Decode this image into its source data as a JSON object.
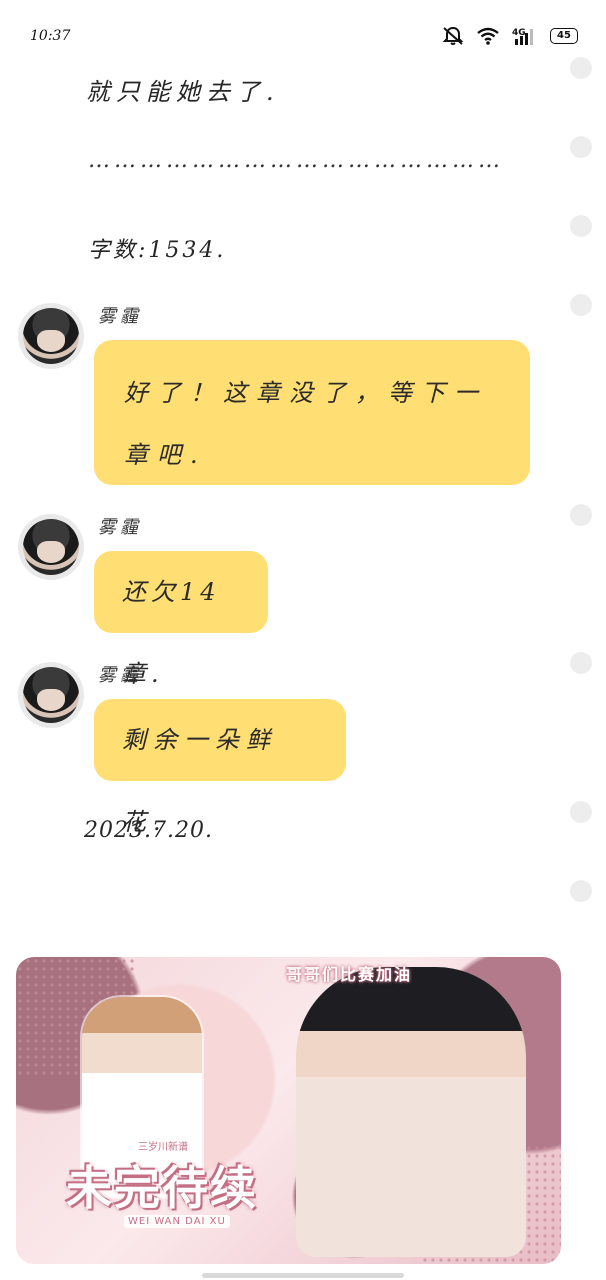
{
  "status_bar": {
    "time": "10:37",
    "battery": "45",
    "icons": [
      "bell-muted-icon",
      "wifi-icon",
      "signal-4g-icon",
      "battery-icon"
    ]
  },
  "content": {
    "line1": "就只能她去了.",
    "dots_line": "…………………………………………",
    "word_count": "字数:1534.",
    "date": "2023.7.20."
  },
  "chat": [
    {
      "name": "雾霾",
      "message": "好了！这章没了，等下一章吧."
    },
    {
      "name": "雾霾",
      "message": "还欠14章."
    },
    {
      "name": "雾霾",
      "message": "剩余一朵鲜花."
    }
  ],
  "banner": {
    "top_text": "哥哥们比赛加油",
    "subtitle": "三岁川新谱",
    "title": "未完待续",
    "pinyin": "WEI WAN DAI XU"
  },
  "colors": {
    "bubble": "#ffde73",
    "dot": "#ededed",
    "banner_accent": "#c46f84"
  }
}
